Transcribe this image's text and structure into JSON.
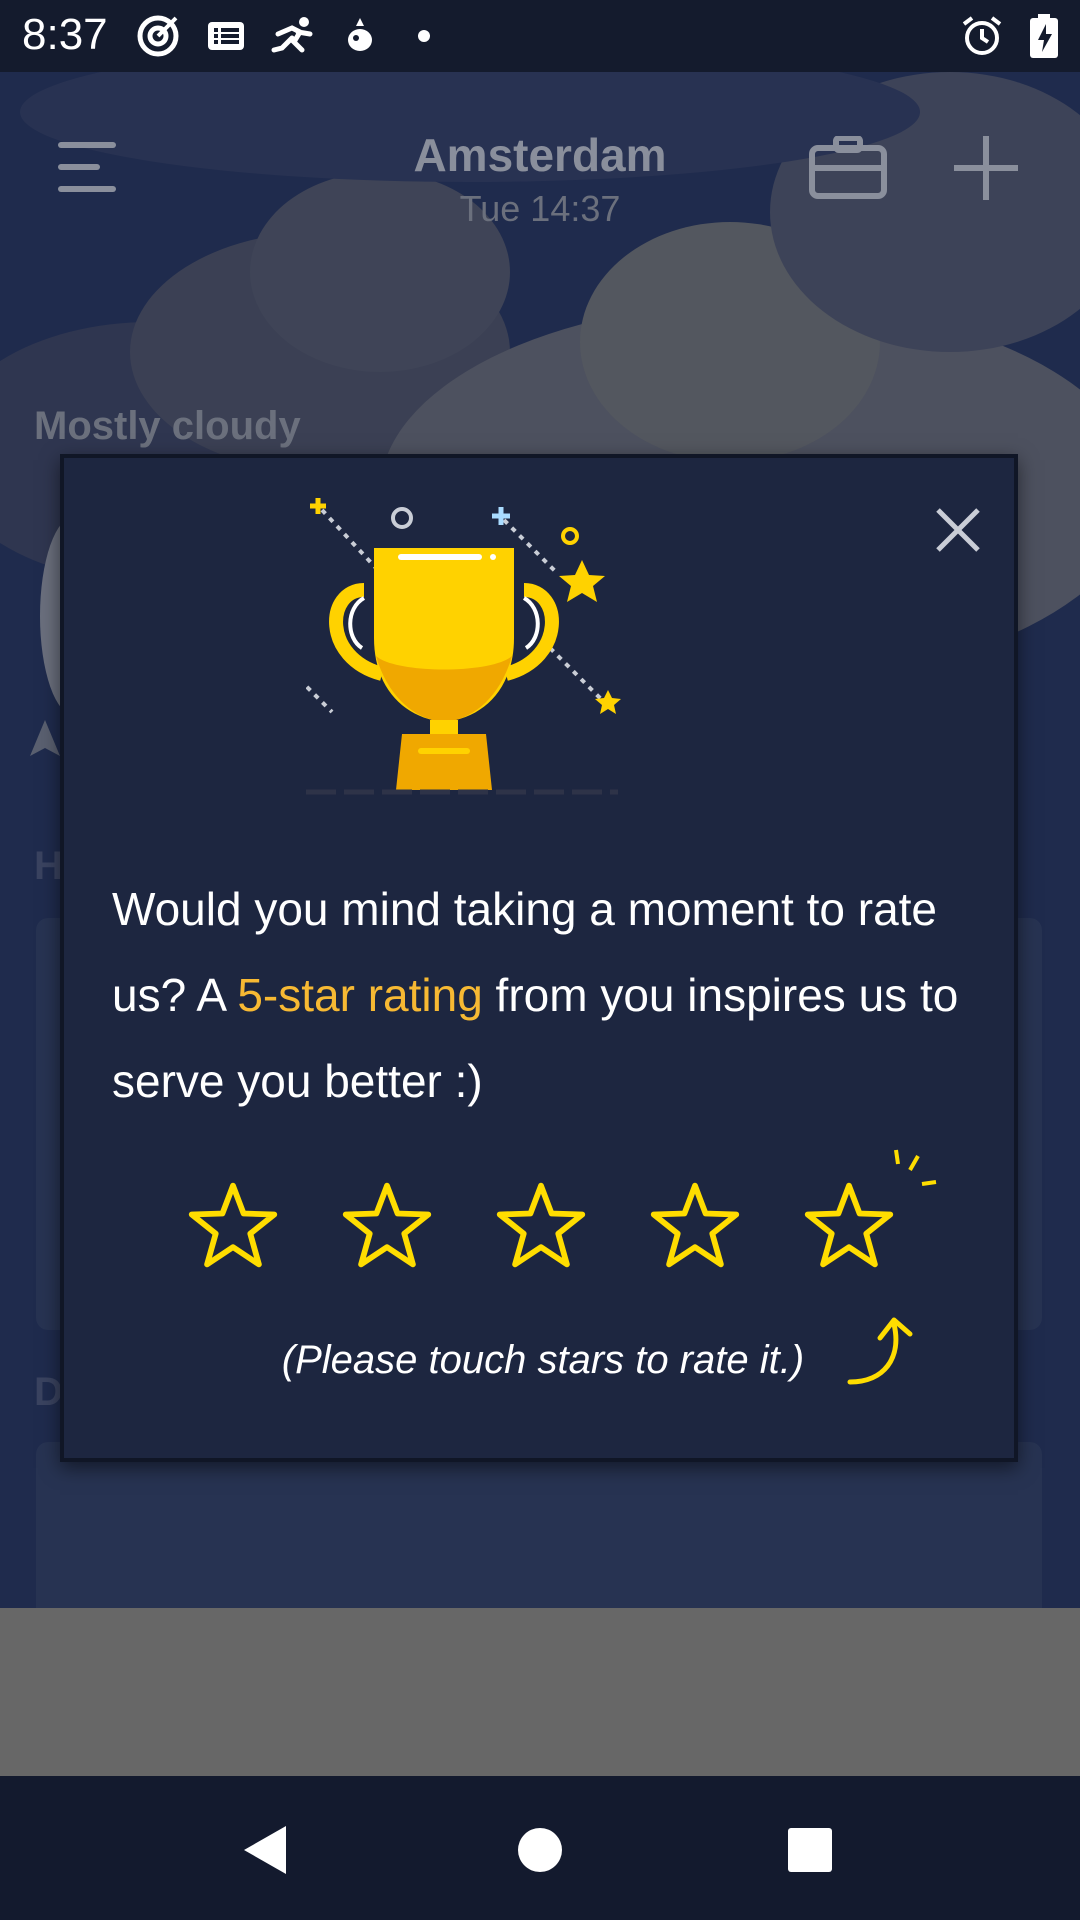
{
  "status_bar": {
    "time": "8:37",
    "icons": [
      "target-icon",
      "list-icon",
      "runner-icon",
      "bird-icon",
      "dot-icon"
    ],
    "right_icons": [
      "alarm-icon",
      "battery-charging-icon"
    ]
  },
  "header": {
    "city": "Amsterdam",
    "datetime": "Tue 14:37"
  },
  "background": {
    "condition": "Mostly cloudy",
    "section_letter_1": "H",
    "section_letter_2": "D"
  },
  "dialog": {
    "text_before": "Would you mind taking a moment to rate us? A ",
    "text_highlight": "5-star rating",
    "text_after": " from you inspires us to serve you better :)",
    "hint": "(Please touch stars to rate it.)",
    "star_count": 5,
    "highlight_color": "#f7b933",
    "star_color": "#ffdd00"
  },
  "nav_bar": {
    "buttons": [
      "back-icon",
      "home-icon",
      "recents-icon"
    ]
  }
}
